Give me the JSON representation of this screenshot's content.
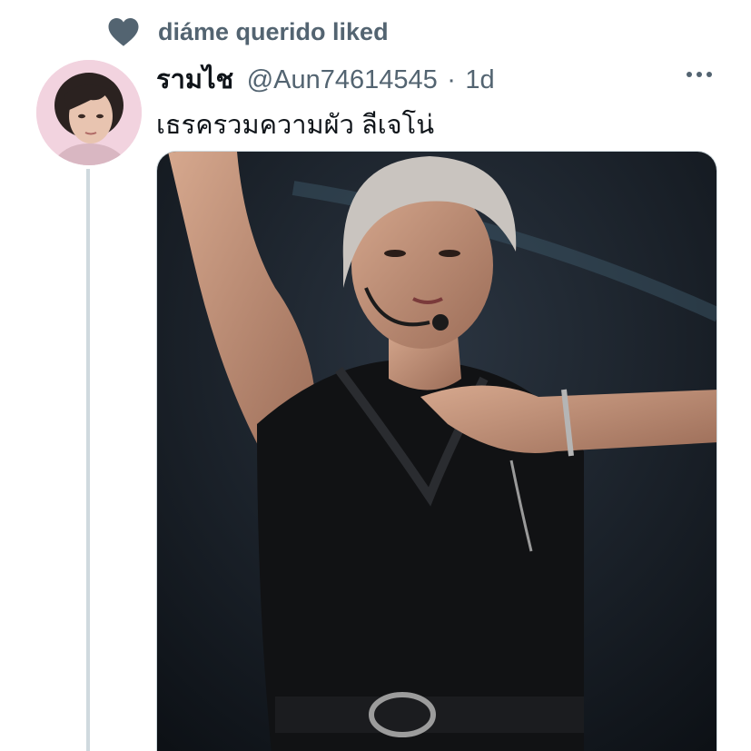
{
  "social_context": {
    "text": "diáme querido liked",
    "icon": "heart-icon"
  },
  "tweet": {
    "display_name": "รามไช",
    "handle": "@Aun74614545",
    "separator": "·",
    "time": "1d",
    "text": "เธรครวมความผัว ลีเจโน่",
    "more_icon": "more-horizontal-icon"
  },
  "colors": {
    "secondary_text": "#536471",
    "primary_text": "#0f1419",
    "thread_line": "#cfd9de"
  }
}
